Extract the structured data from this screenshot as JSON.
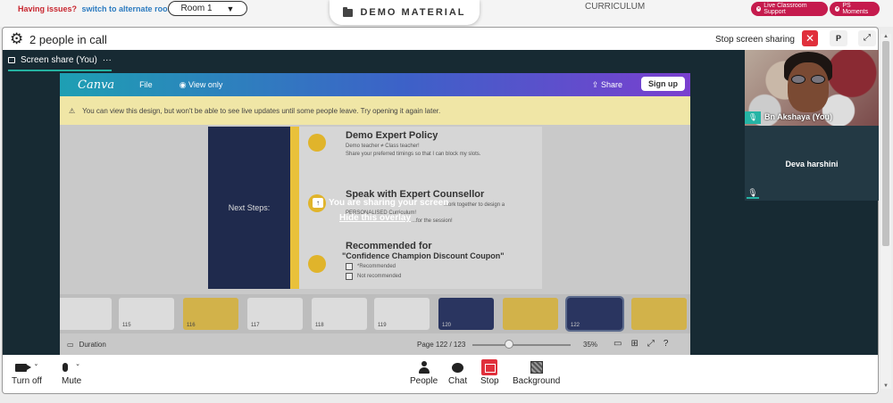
{
  "topbar": {
    "issue_question": "Having issues?",
    "alternate_link": "switch to alternate room",
    "room_label": "Room 1",
    "demo_label": "DEMO MATERIAL",
    "curriculum_label": "CURRICULUM",
    "live_support_label": "Live Classroom Support",
    "ps_moments_label": "PS Moments"
  },
  "call": {
    "people_count": "2 people in call",
    "stop_sharing_label": "Stop screen sharing",
    "p_button": "P",
    "screen_share_tab": "Screen share (You)",
    "tab_more": "···"
  },
  "shared": {
    "canva_logo": "Canva",
    "menu_file": "File",
    "menu_view_only": "View only",
    "share_label": "Share",
    "signup_label": "Sign up",
    "warning_text": "You can view this design, but won't be able to see live updates until some people leave. Try opening it again later.",
    "slide_left_title": "Next Steps:",
    "section1_title": "Demo Expert Policy",
    "section1_line1": "Demo teacher ≠ Class teacher!",
    "section1_line2": "Share your preferred timings so that I can block my slots.",
    "section2_title": "Speak with Expert Counsellor",
    "section2_line1": "...ork together to design a",
    "section2_line2": "PERSONALISED Curriculum!",
    "section2_line3": "...for the session!",
    "section3_title": "Recommended for",
    "section3_subtitle": "\"Confidence Champion Discount Coupon\"",
    "check1": "*Recommended",
    "check2": "Not recommended",
    "overlay_title": "You are sharing your screen",
    "overlay_hide": "Hide this overlay",
    "thumb_numbers": [
      "",
      "115",
      "116",
      "117",
      "118",
      "119",
      "120",
      "",
      "122",
      ""
    ],
    "duration_label": "Duration",
    "page_label": "Page 122 / 123",
    "zoom_label": "35%"
  },
  "participants": {
    "self_name": "Bn Akshaya (You)",
    "other_name": "Deva harshini"
  },
  "toolbar": {
    "turn_off": "Turn off",
    "mute": "Mute",
    "people": "People",
    "chat": "Chat",
    "stop": "Stop",
    "background": "Background"
  },
  "colors": {
    "accent_teal": "#25b4a5",
    "alert_red": "#e0303c",
    "support_pink": "#c51b4d",
    "issue_red": "#c8262f",
    "link_blue": "#2c7bc0"
  }
}
